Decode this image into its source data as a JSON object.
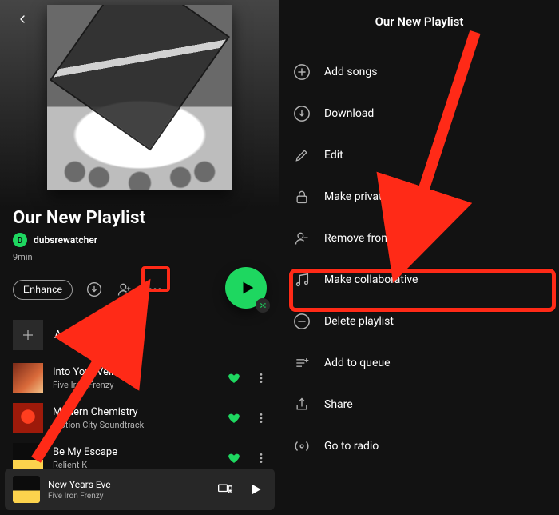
{
  "left": {
    "playlist_title": "Our New Playlist",
    "author_initial": "D",
    "author": "dubsrewatcher",
    "duration": "9min",
    "enhance_label": "Enhance",
    "add_songs_label": "Add songs",
    "tracks": [
      {
        "title": "Into Your Veins",
        "artist": "Five Iron Frenzy"
      },
      {
        "title": "Modern Chemistry",
        "artist": "Motion City Soundtrack"
      },
      {
        "title": "Be My Escape",
        "artist": "Relient K"
      }
    ],
    "now_playing": {
      "title": "New Years Eve",
      "artist": "Five Iron Frenzy"
    }
  },
  "right": {
    "title": "Our New Playlist",
    "options": {
      "add_songs": "Add songs",
      "download": "Download",
      "edit": "Edit",
      "make_private": "Make private",
      "remove_profile": "Remove from profile",
      "make_collab": "Make collaborative",
      "delete": "Delete playlist",
      "add_queue": "Add to queue",
      "share": "Share",
      "goto_radio": "Go to radio"
    }
  }
}
